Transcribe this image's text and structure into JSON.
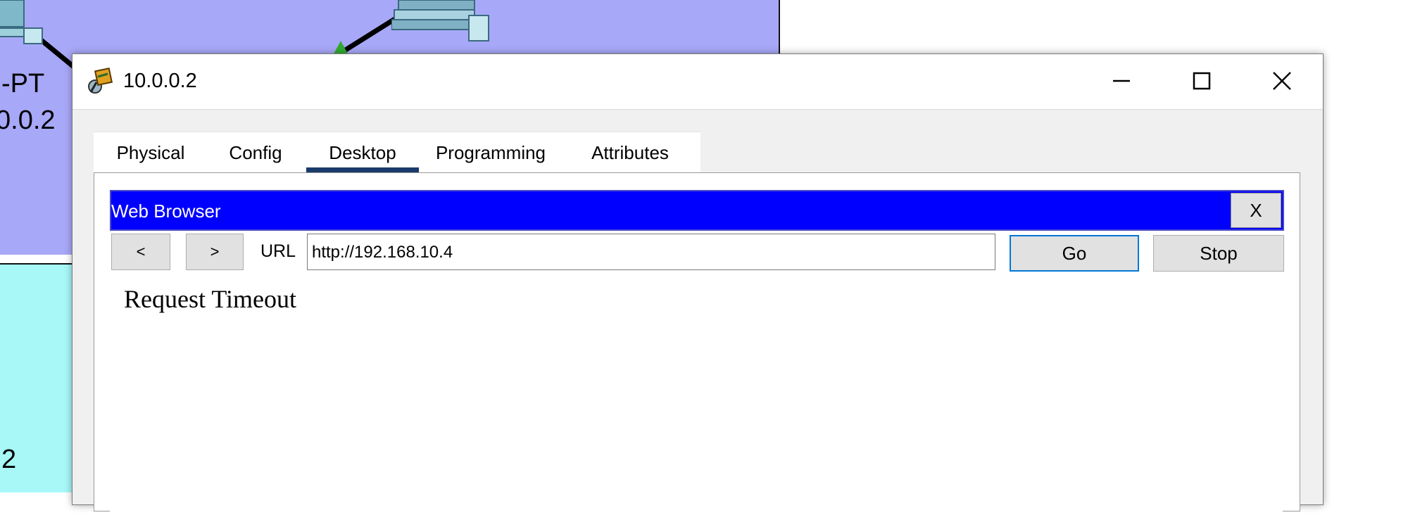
{
  "workspace": {
    "device_label_1": "-PT",
    "device_label_2": "0.0.2",
    "device_label_3": "2"
  },
  "window": {
    "title": "10.0.0.2"
  },
  "tabs": [
    {
      "label": "Physical"
    },
    {
      "label": "Config"
    },
    {
      "label": "Desktop"
    },
    {
      "label": "Programming"
    },
    {
      "label": "Attributes"
    }
  ],
  "active_tab": "Desktop",
  "browser": {
    "title": "Web Browser",
    "close_label": "X",
    "back_label": "<",
    "forward_label": ">",
    "url_label": "URL",
    "url_value": "http://192.168.10.4",
    "go_label": "Go",
    "stop_label": "Stop",
    "page_content": "Request Timeout"
  },
  "colors": {
    "workspace_bg": "#a8a8f8",
    "workspace_lower_bg": "#a8f8f8",
    "browser_header": "#0000ff",
    "active_tab_indicator": "#1a3a6a"
  },
  "icons": [
    "pc-icon",
    "router-icon",
    "minimize-icon",
    "maximize-icon",
    "close-icon"
  ]
}
